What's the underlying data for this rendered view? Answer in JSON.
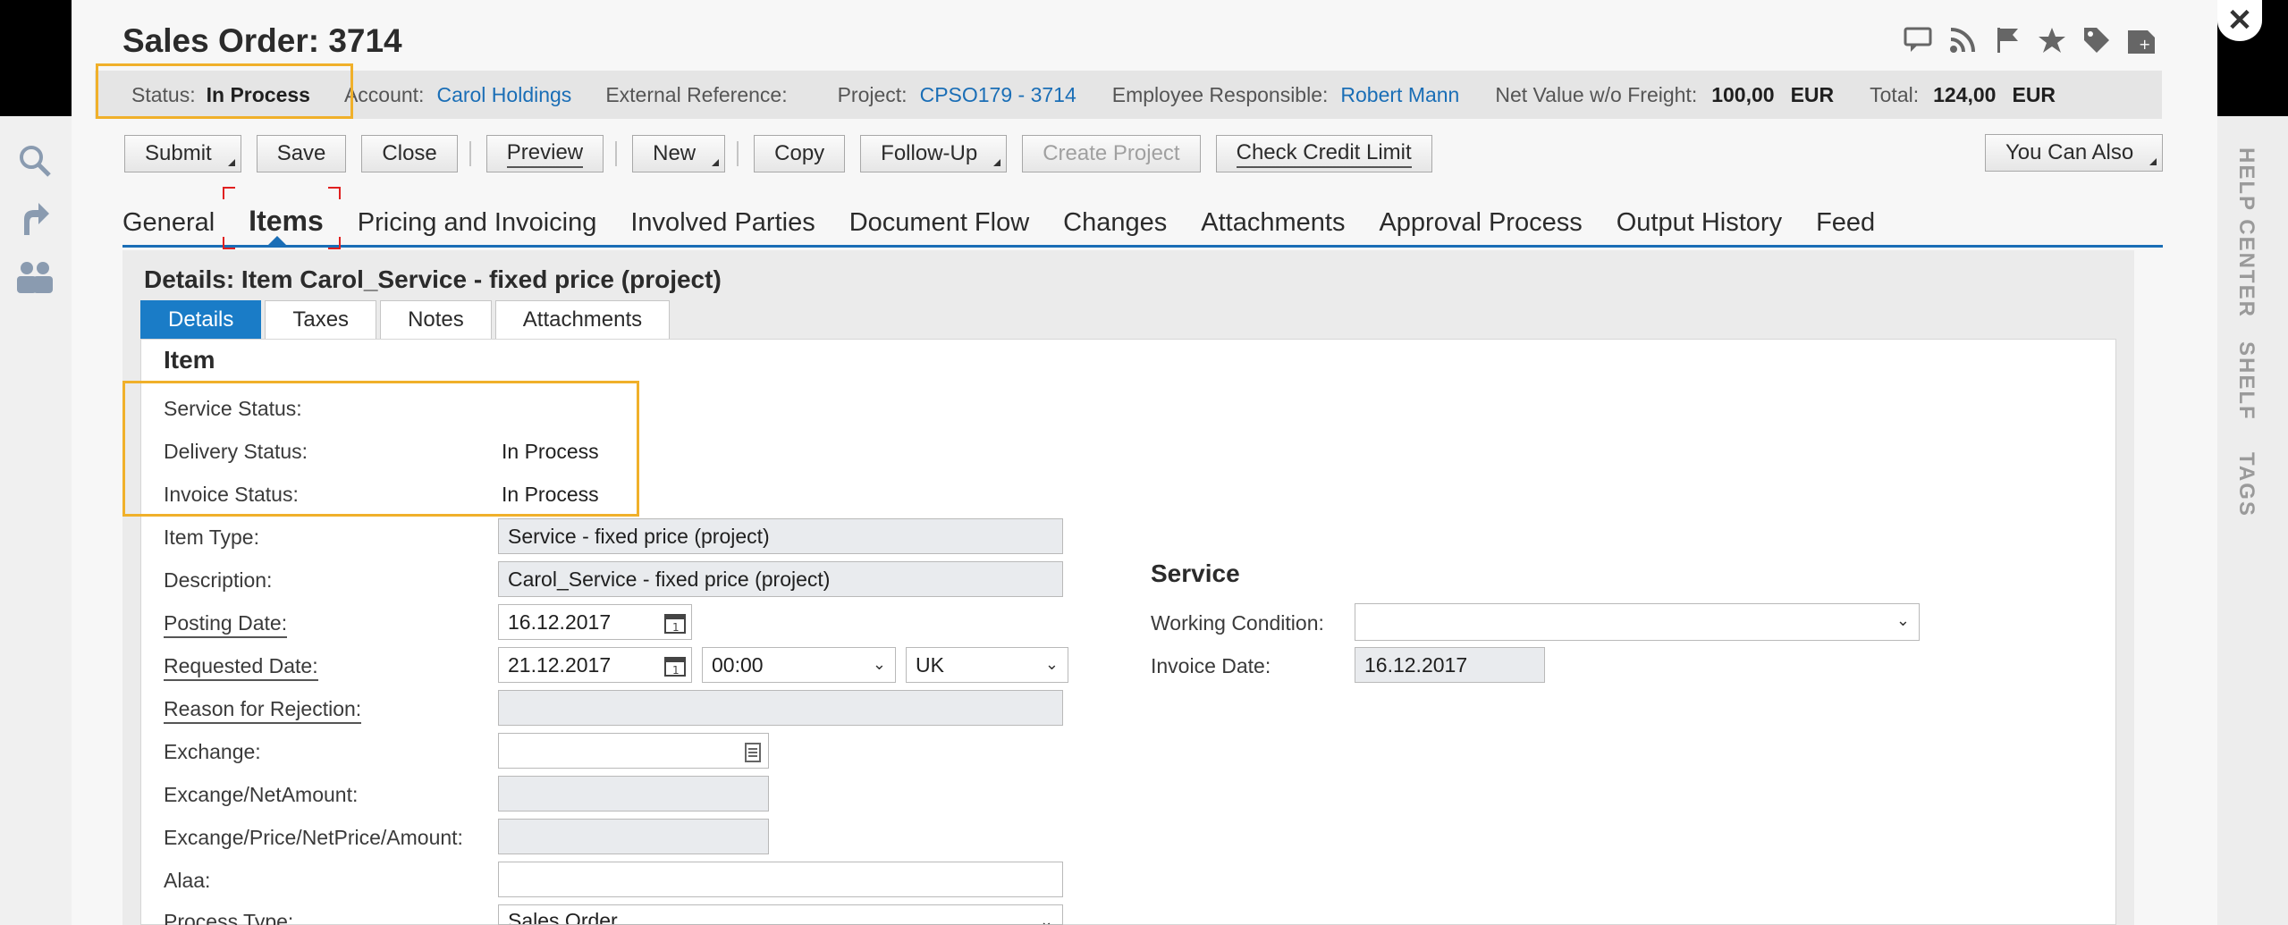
{
  "title": "Sales Order: 3714",
  "infobar": {
    "status_label": "Status:",
    "status_value": "In Process",
    "account_label": "Account:",
    "account_value": "Carol Holdings",
    "extref_label": "External Reference:",
    "project_label": "Project:",
    "project_value": "CPSO179 - 3714",
    "employee_label": "Employee Responsible:",
    "employee_value": "Robert Mann",
    "netvalue_label": "Net Value w/o Freight:",
    "netvalue_amount": "100,00",
    "netvalue_currency": "EUR",
    "total_label": "Total:",
    "total_amount": "124,00",
    "total_currency": "EUR"
  },
  "toolbar": {
    "submit": "Submit",
    "save": "Save",
    "close": "Close",
    "preview": "Preview",
    "new": "New",
    "copy": "Copy",
    "follow_up": "Follow-Up",
    "create_project": "Create Project",
    "check_credit_limit": "Check Credit Limit",
    "you_can_also": "You Can Also"
  },
  "tabs": [
    "General",
    "Items",
    "Pricing and Invoicing",
    "Involved Parties",
    "Document Flow",
    "Changes",
    "Attachments",
    "Approval Process",
    "Output History",
    "Feed"
  ],
  "details": {
    "title": "Details: Item Carol_Service - fixed price (project)",
    "subtabs": [
      "Details",
      "Taxes",
      "Notes",
      "Attachments"
    ],
    "item_section": "Item",
    "service_status_label": "Service Status:",
    "delivery_status_label": "Delivery Status:",
    "delivery_status_value": "In Process",
    "invoice_status_label": "Invoice Status:",
    "invoice_status_value": "In Process",
    "item_type_label": "Item Type:",
    "item_type_value": "Service - fixed price (project)",
    "description_label": "Description:",
    "description_value": "Carol_Service - fixed price (project)",
    "posting_date_label": "Posting Date:",
    "posting_date_value": "16.12.2017",
    "requested_date_label": "Requested Date:",
    "requested_date_value": "21.12.2017",
    "requested_time_value": "00:00",
    "requested_tz_value": "UK",
    "reason_rejection_label": "Reason for Rejection:",
    "exchange_label": "Exchange:",
    "excange_netamount_label": "Excange/NetAmount:",
    "excange_price_label": "Excange/Price/NetPrice/Amount:",
    "alaa_label": "Alaa:",
    "process_type_label": "Process Type:",
    "process_type_value": "Sales Order",
    "service_section": "Service",
    "working_condition_label": "Working Condition:",
    "invoice_date_label": "Invoice Date:",
    "invoice_date_value": "16.12.2017"
  },
  "right_rail": {
    "help_center": "HELP CENTER",
    "shelf": "SHELF",
    "tags": "TAGS"
  },
  "icons": {
    "left_rail": [
      "search-icon",
      "share-arrow-icon",
      "people-icon"
    ],
    "title_bar": [
      "feedback-icon",
      "rss-icon",
      "flag-icon",
      "star-icon",
      "tag-icon",
      "new-window-icon"
    ]
  },
  "colors": {
    "accent": "#1a6eb6",
    "highlight": "#f0b02a",
    "active_subtab": "#1a7cc7"
  }
}
